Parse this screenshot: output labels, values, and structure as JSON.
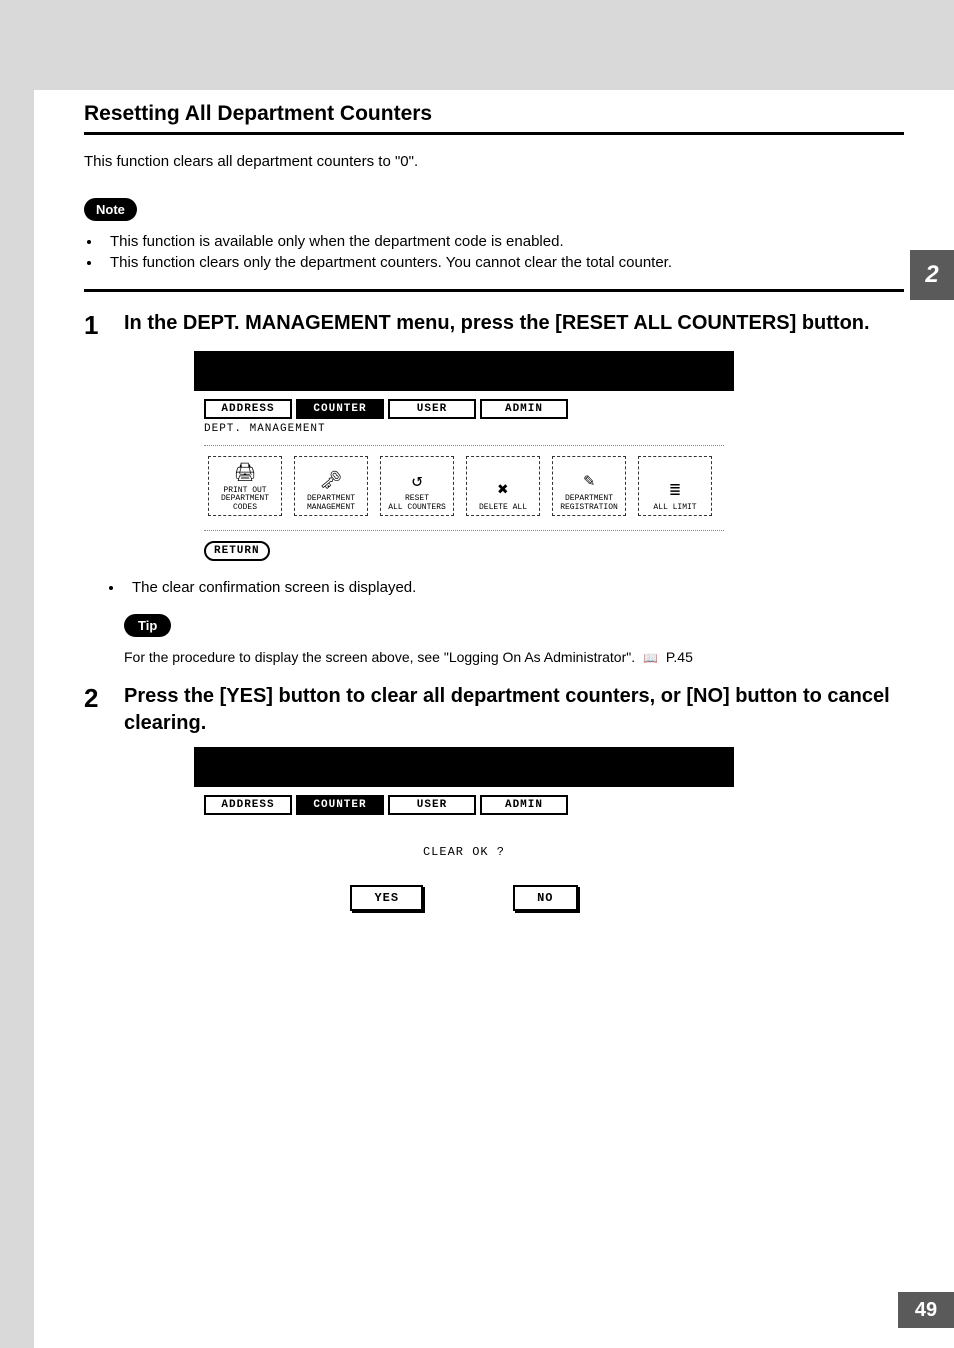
{
  "chapter_tab": "2",
  "page_number": "49",
  "section_title": "Resetting All Department Counters",
  "intro": "This function clears all department counters to \"0\".",
  "note_label": "Note",
  "note_items": [
    "This function is available only when the department code is enabled.",
    "This function clears only the department counters.  You cannot clear the total counter."
  ],
  "step1": {
    "num": "1",
    "text": "In the DEPT. MANAGEMENT menu, press the [RESET ALL COUNTERS] button.",
    "after_bullet": "The clear confirmation screen is displayed."
  },
  "screen1": {
    "tabs": [
      "ADDRESS",
      "COUNTER",
      "USER",
      "ADMIN"
    ],
    "active_tab_index": 1,
    "subheader": "DEPT. MANAGEMENT",
    "buttons": [
      "PRINT OUT\nDEPARTMENT CODES",
      "DEPARTMENT\nMANAGEMENT",
      "RESET\nALL COUNTERS",
      "DELETE ALL",
      "DEPARTMENT\nREGISTRATION",
      "ALL LIMIT"
    ],
    "return_label": "RETURN"
  },
  "tip_label": "Tip",
  "tip_text_prefix": "For the procedure to display the screen above, see \"Logging On As Administrator\".",
  "tip_ref": "P.45",
  "step2": {
    "num": "2",
    "text": "Press the [YES] button to clear all department counters, or [NO] button to cancel clearing."
  },
  "screen2": {
    "tabs": [
      "ADDRESS",
      "COUNTER",
      "USER",
      "ADMIN"
    ],
    "active_tab_index": 1,
    "question": "CLEAR OK ?",
    "yes": "YES",
    "no": "NO"
  }
}
